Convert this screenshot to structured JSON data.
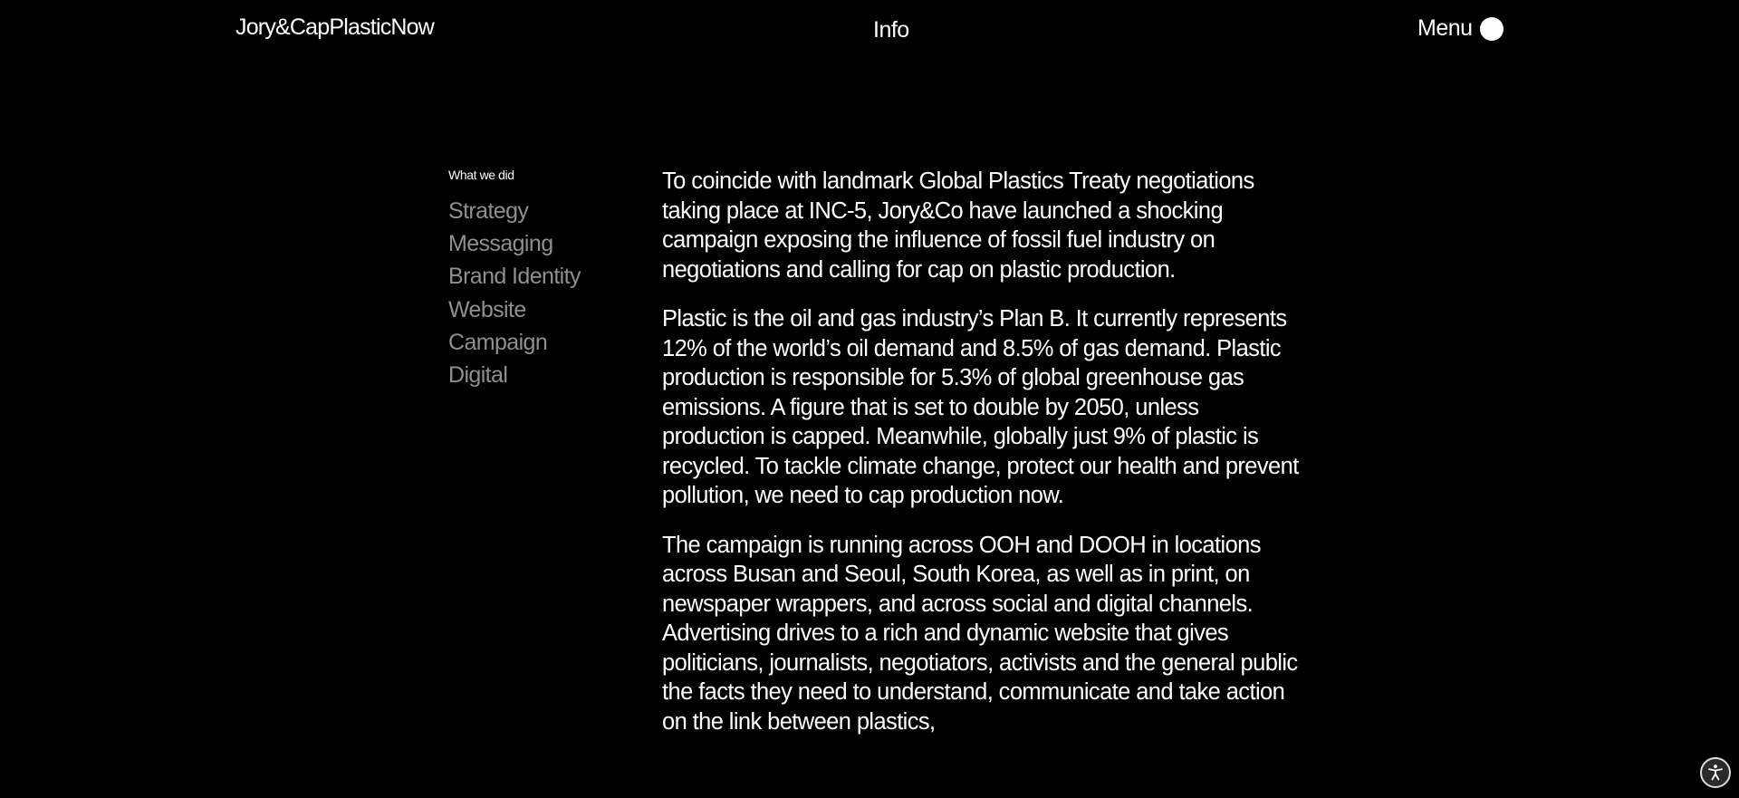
{
  "header": {
    "brand": "Jory&CapPlasticNow",
    "info_link": "Info",
    "menu_label": "Menu"
  },
  "sidebar": {
    "heading": "What we did",
    "items": [
      {
        "label": "Strategy"
      },
      {
        "label": "Messaging"
      },
      {
        "label": "Brand Identity"
      },
      {
        "label": "Website"
      },
      {
        "label": "Campaign"
      },
      {
        "label": "Digital"
      }
    ]
  },
  "content": {
    "paragraphs": [
      "To coincide with landmark Global Plastics Treaty negotiations taking place at INC-5, Jory&Co have launched a shocking campaign exposing the influence of fossil fuel industry on negotiations and calling for cap on plastic production.",
      "Plastic is the oil and gas industry’s Plan B. It currently represents 12% of the world’s oil demand and 8.5% of gas demand. Plastic production is responsible for 5.3% of global greenhouse gas emissions. A figure that is set to double by 2050, unless production is capped. Meanwhile, globally just 9% of plastic is recycled. To tackle climate change, protect our health and prevent pollution, we need to cap production now.",
      "The campaign is running across OOH and DOOH in locations across Busan and Seoul, South Korea, as well as in print, on newspaper wrappers, and across social and digital channels. Advertising drives to a rich and dynamic website that gives politicians, journalists, negotiators, activists and the general public the facts they need to understand, communicate and take action on the link between plastics,"
    ]
  },
  "accessibility": {
    "icon": "accessibility-icon"
  },
  "colors": {
    "background": "#000000",
    "text": "#ffffff",
    "muted": "#8f8f8f"
  }
}
